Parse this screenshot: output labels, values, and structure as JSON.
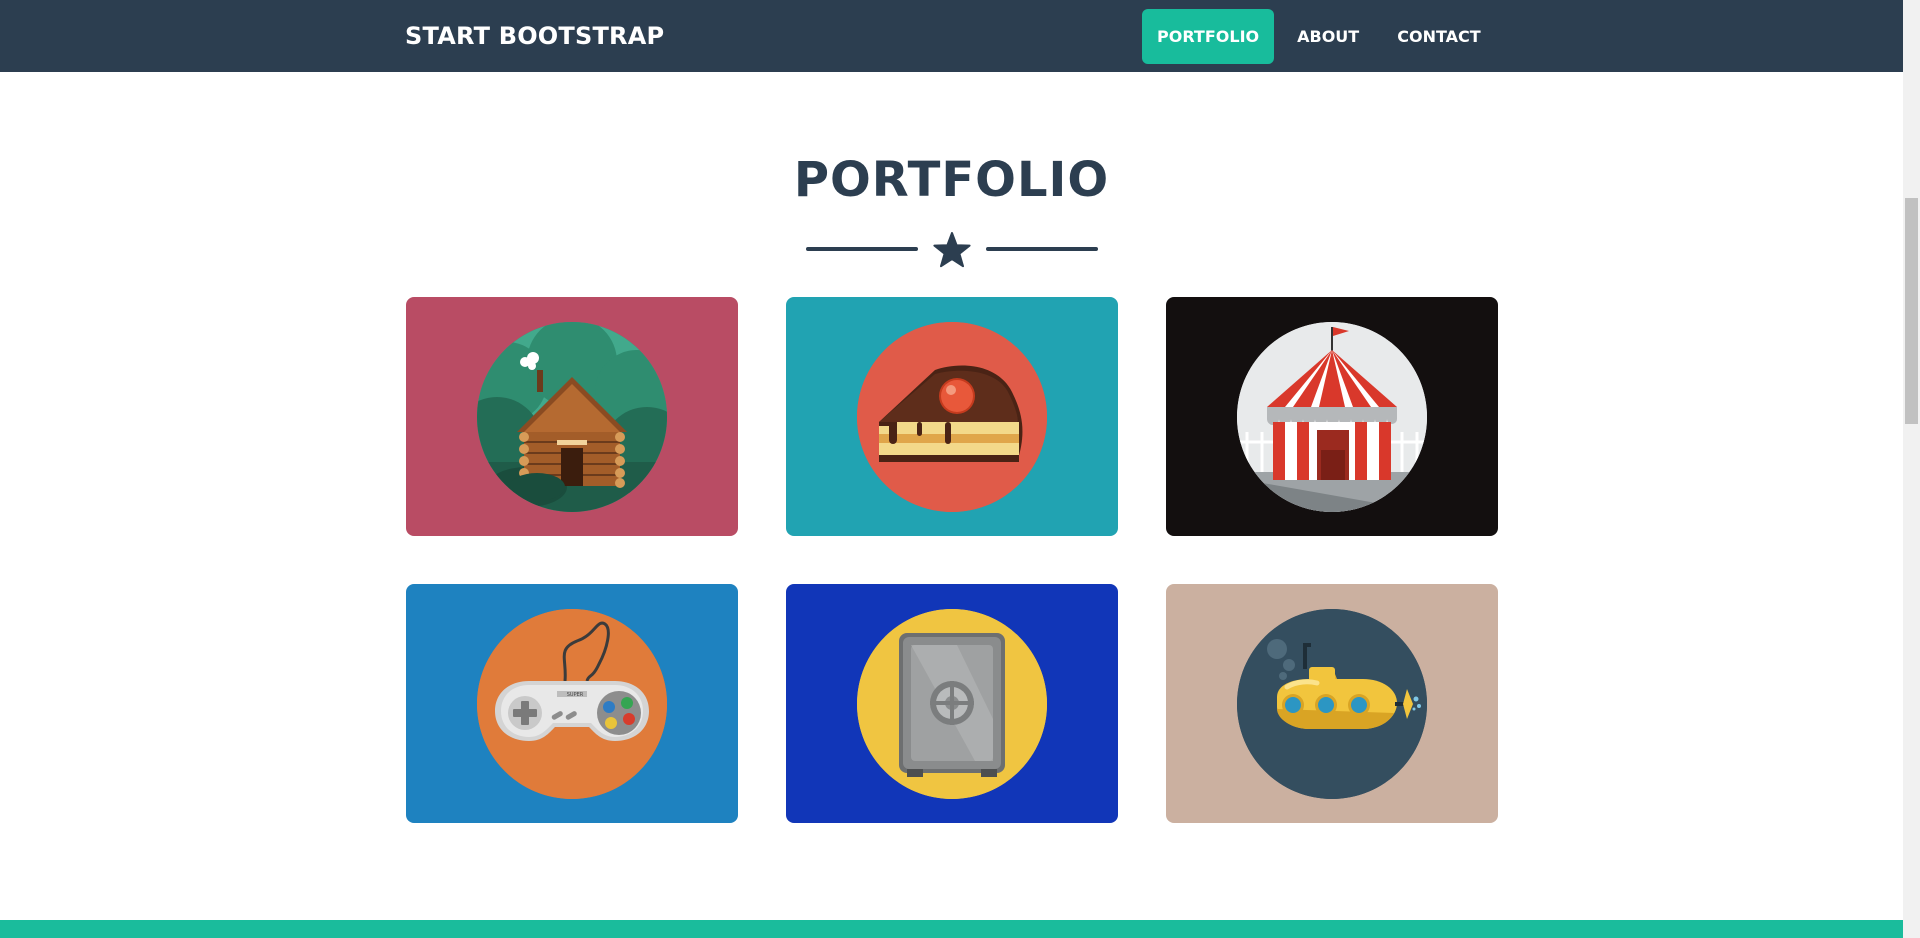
{
  "navbar": {
    "brand": "START BOOTSTRAP",
    "links": [
      "PORTFOLIO",
      "ABOUT",
      "CONTACT"
    ],
    "active": "PORTFOLIO",
    "active_color": "#18bc9c",
    "background": "#2c3e50"
  },
  "portfolio": {
    "title": "PORTFOLIO",
    "divider_icon": "star-icon",
    "items": [
      {
        "icon": "log-cabin-icon",
        "card_color": "#b94c64",
        "circle_color": "#2e7d62"
      },
      {
        "icon": "cake-icon",
        "card_color": "#21a3b2",
        "circle_color": "#e05b49"
      },
      {
        "icon": "circus-tent-icon",
        "card_color": "#130f0f",
        "circle_color": "#e8eaeb"
      },
      {
        "icon": "game-controller-icon",
        "card_color": "#1e82c0",
        "circle_color": "#e07b3a"
      },
      {
        "icon": "safe-icon",
        "card_color": "#1136b8",
        "circle_color": "#f0c541"
      },
      {
        "icon": "submarine-icon",
        "card_color": "#cbb0a0",
        "circle_color": "#344e5f"
      }
    ]
  },
  "footer": {
    "accent": "#1abc9c"
  }
}
